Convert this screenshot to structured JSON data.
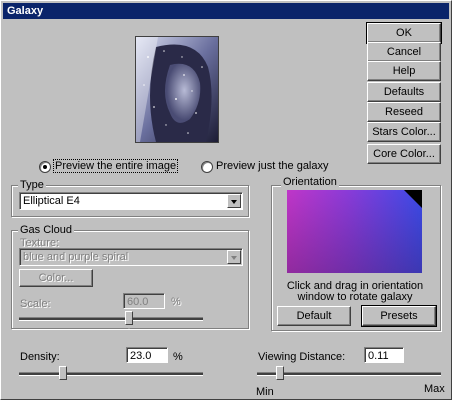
{
  "window": {
    "title": "Galaxy"
  },
  "buttons": {
    "ok": "OK",
    "cancel": "Cancel",
    "help": "Help",
    "defaults": "Defaults",
    "reseed": "Reseed",
    "stars_color": "Stars Color...",
    "core_color": "Core Color..."
  },
  "preview_options": {
    "entire": "Preview the entire image",
    "galaxy": "Preview just the galaxy",
    "selected": "entire"
  },
  "type_group": {
    "label": "Type",
    "value": "Elliptical E4"
  },
  "gas_cloud": {
    "label": "Gas Cloud",
    "texture_label": "Texture:",
    "texture_value": "blue and purple spiral",
    "color_button": "Color...",
    "scale_label": "Scale:",
    "scale_value": "60.0",
    "scale_unit": "%",
    "scale_level": 0.6
  },
  "orientation": {
    "label": "Orientation",
    "hint_line1": "Click and drag in orientation",
    "hint_line2": "window to rotate galaxy",
    "default_button": "Default",
    "presets_button": "Presets"
  },
  "density": {
    "label": "Density:",
    "value": "23.0",
    "unit": "%",
    "level": 0.23
  },
  "viewing_distance": {
    "label": "Viewing Distance:",
    "value": "0.11",
    "min_label": "Min",
    "max_label": "Max",
    "level": 0.11
  }
}
